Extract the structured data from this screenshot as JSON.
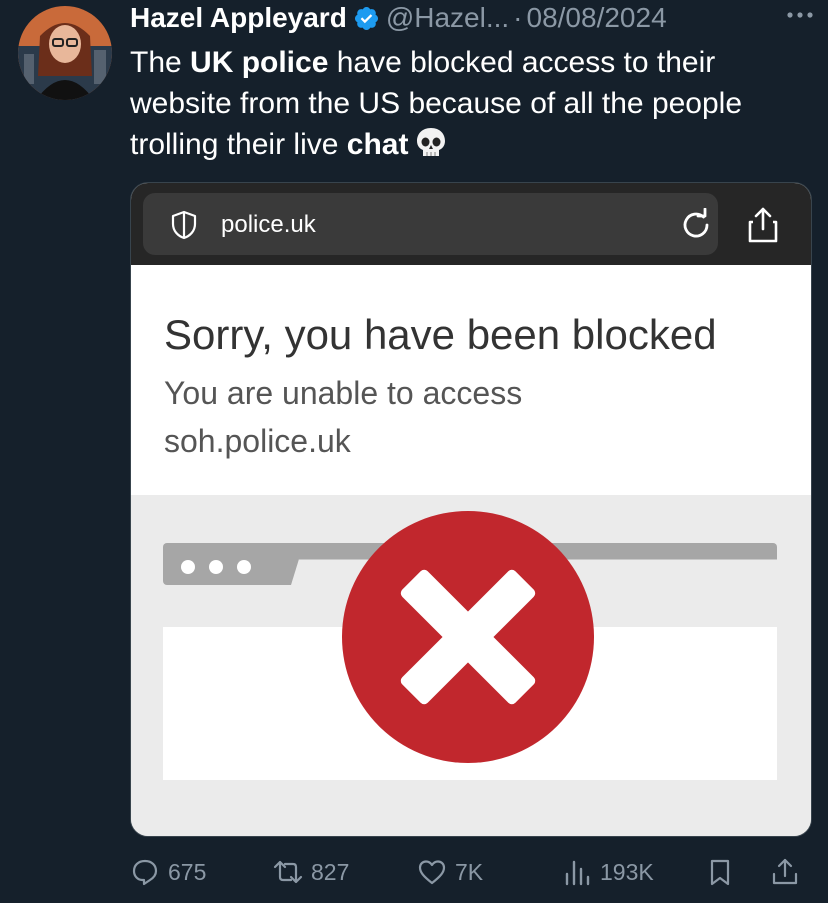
{
  "author": {
    "name": "Hazel Appleyard",
    "handle": "@Hazel...",
    "separator": "·",
    "date": "08/08/2024",
    "avatar_icon": "woman-with-glasses-avatar",
    "verified_icon": "verified-badge-icon"
  },
  "tweet": {
    "t1": "The ",
    "t2": "UK police",
    "t3": " have blocked access to their website from the US because of all the people trolling their live ",
    "t4": "chat",
    "emoji": "skull-emoji"
  },
  "media": {
    "url": "police.uk",
    "blocked_title": "Sorry, you have been blocked",
    "blocked_line1": "You are unable to access",
    "blocked_line2": "soh.police.uk",
    "illustration": "browser-window-with-red-x-icon"
  },
  "actions": {
    "replies": "675",
    "reposts": "827",
    "likes": "7K",
    "views": "193K"
  },
  "colors": {
    "background": "#15202b",
    "muted": "#8b98a5",
    "verified": "#1d9bf0",
    "error_red": "#c1272d"
  }
}
